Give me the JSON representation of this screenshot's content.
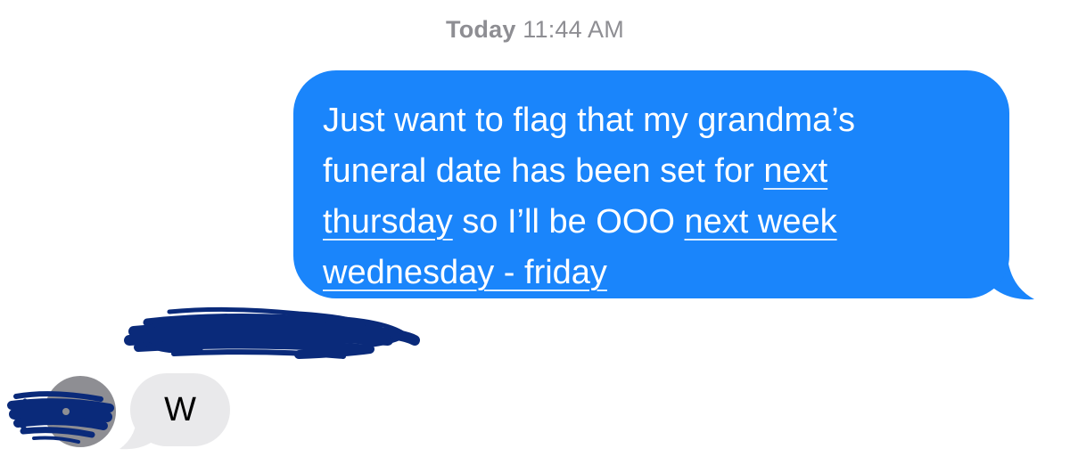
{
  "timestamp": {
    "day": "Today",
    "time": "11:44 AM"
  },
  "outgoing_message": {
    "line1": "Just want to flag that my grandma’s",
    "line2_text": "funeral date has been set for ",
    "line2_link": "next",
    "line3_link": "thursday",
    "line3_text": " so I’ll be OOO ",
    "line3_link2": "next week",
    "line4_link": "wednesday - friday"
  },
  "incoming_message": {
    "text": "W"
  },
  "colors": {
    "outgoing_bubble": "#1a85fb",
    "incoming_bubble": "#e9e9eb",
    "timestamp": "#8e8e93",
    "redaction": "#0a2a7a"
  }
}
